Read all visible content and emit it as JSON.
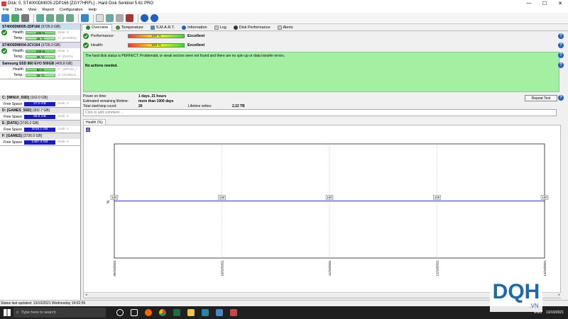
{
  "window": {
    "title": "Disk: 0, ST4000DM005-2DP166 [ZGY7HRFL]  -  Hard Disk Sentinel 5.61 PRO",
    "minimize": "—",
    "maximize": "☐",
    "close": "✕"
  },
  "menu": [
    "File",
    "Disk",
    "View",
    "Report",
    "Configuration",
    "Help"
  ],
  "disks": [
    {
      "name": "ST4000DM005-2DP166",
      "size": "(3726.0 GB)",
      "health": "100 %",
      "temp": "25 °C",
      "extra1": "Disk: 0",
      "extra2": "F: [GAMES]",
      "selected": true
    },
    {
      "name": "ST4000DM004-2CV104",
      "size": "(3726.0 GB)",
      "health": "100 %",
      "temp": "39 °C",
      "extra1": "Disk: 1",
      "extra2": "E: [DATA]",
      "selected": false
    },
    {
      "name": "Samsung SSD 860 EVO 500GB",
      "size": "(465.8 GB)",
      "health": "80 %",
      "temp": "38 °C",
      "extra1": "C: [WIN10_SS",
      "extra2": "D: [GAMES_S",
      "selected": false
    }
  ],
  "labels": {
    "health": "Health:",
    "temp": "Temp.:",
    "free_space": "Free Space"
  },
  "volumes": [
    {
      "name": "C: [WIN10_SSD]",
      "size": "(162.0 GB)",
      "free": "27.0 GB",
      "disk": "Disk: 2"
    },
    {
      "name": "D: [GAMES_SSD]",
      "size": "(302.7 GB)",
      "free": "85.6 GB",
      "disk": "Disk: 2"
    },
    {
      "name": "E: [DATA]",
      "size": "(3726.0 GB)",
      "free": "2019.1 GB",
      "disk": "Disk: 1"
    },
    {
      "name": "F: [GAMES]",
      "size": "(3726.0 GB)",
      "free": "1487.3 GB",
      "disk": "Disk: 0"
    }
  ],
  "tabs": [
    "Overview",
    "Temperature",
    "S.M.A.R.T.",
    "Information",
    "Log",
    "Disk Performance",
    "Alerts"
  ],
  "overview": {
    "performance_label": "Performance:",
    "performance_value": "100 %",
    "performance_status": "Excellent",
    "health_label": "Health:",
    "health_value": "100 %",
    "health_status": "Excellent",
    "status_text": "The hard disk status is PERFECT. Problematic or weak sectors were not found and there are no spin up or data transfer errors.",
    "action_text": "No actions needed.",
    "power_on_label": "Power on time:",
    "power_on_value": "1 days, 21 hours",
    "lifetime_label": "Estimated remaining lifetime:",
    "lifetime_value": "more than 1000 days",
    "startstop_label": "Total start/stop count:",
    "startstop_value": "26",
    "writes_label": "Lifetime writes:",
    "writes_value": "2.22 TB",
    "repeat_button": "Repeat Test",
    "comment_placeholder": "Click to add comment ...",
    "health_tab": "Health (%)"
  },
  "chart_data": {
    "type": "line",
    "x": [
      "09/10/2021",
      "10/10/2021",
      "11/10/2021",
      "12/10/2021",
      "13/10/2021"
    ],
    "series": [
      {
        "values": [
          100,
          100,
          100,
          100,
          100
        ]
      }
    ],
    "ylabel": "%",
    "color": "#3333cc"
  },
  "statusbar": "Status last updated: 13/10/2021 Wednesday 14:02:59",
  "taskbar": {
    "search_placeholder": "Type here to search",
    "lang": "ENG",
    "time": "",
    "date": "13/10/2021"
  },
  "logo": {
    "main": "DQH",
    "sub": ".VN"
  }
}
